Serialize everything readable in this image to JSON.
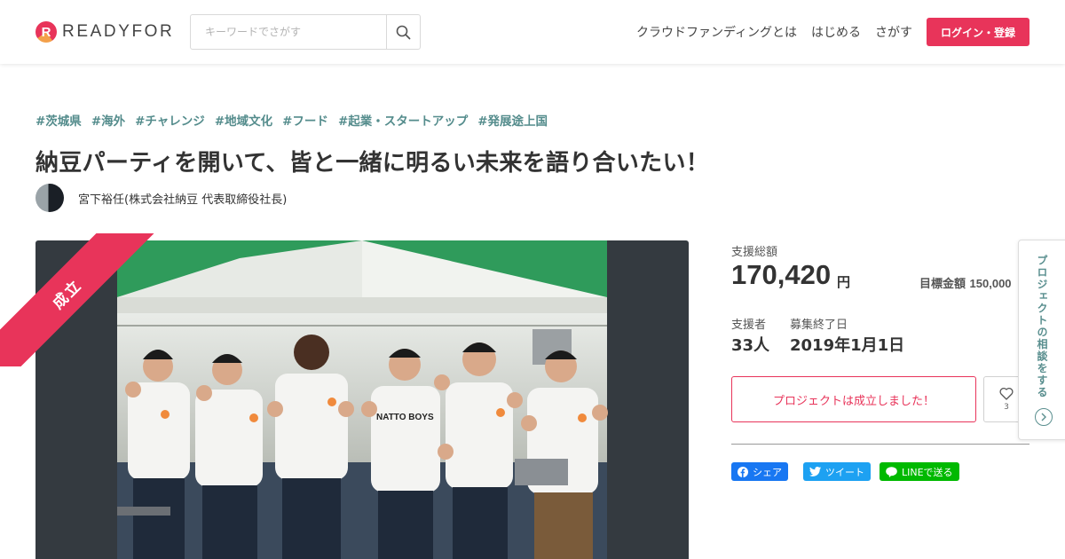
{
  "header": {
    "logo_text": "READYFOR",
    "logo_mark": "R",
    "search_placeholder": "キーワードでさがす",
    "search_icon": "search-icon",
    "nav": [
      "クラウドファンディングとは",
      "はじめる",
      "さがす"
    ],
    "login_label": "ログイン・登録",
    "accent_color": "#e8345a"
  },
  "project": {
    "tags": [
      "#茨城県",
      "#海外",
      "#チャレンジ",
      "#地域文化",
      "#フード",
      "#起業・スタートアップ",
      "#発展途上国"
    ],
    "title": "納豆パーティを開いて、皆と一緒に明るい未来を語り合いたい！",
    "owner_name": "宮下裕任(株式会社納豆 代表取締役社長)",
    "status_ribbon": "成立",
    "photo_shirt_text": "NATTO BOYS"
  },
  "stats": {
    "total_label": "支援総額",
    "total_amount": "170,420",
    "total_unit": "円",
    "goal_label": "目標金額",
    "goal_amount": "150,000",
    "supporters_label": "支援者",
    "supporters_value": "33人",
    "end_label": "募集終了日",
    "end_value": "2019年1月1日"
  },
  "actions": {
    "success_label": "プロジェクトは成立しました！",
    "favorite_count": "3",
    "share_facebook": "シェア",
    "share_twitter": "ツイート",
    "share_line": "LINEで送る"
  },
  "side_tab": {
    "label": "プロジェクトの相談をする"
  }
}
